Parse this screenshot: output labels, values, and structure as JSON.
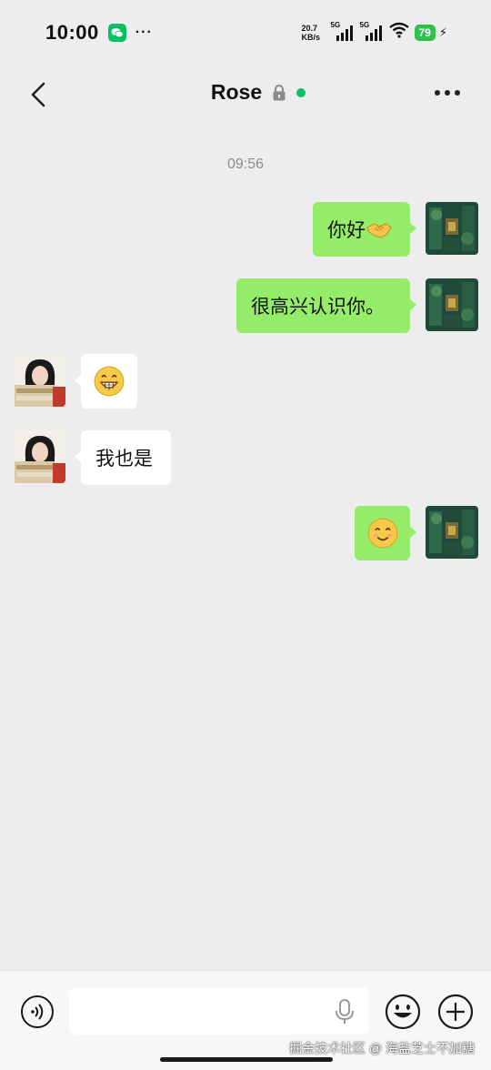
{
  "status_bar": {
    "time": "10:00",
    "net_speed_value": "20.7",
    "net_speed_unit": "KB/s",
    "sim1_label": "5G",
    "sim2_label": "5G",
    "battery": "79",
    "charging_icon": "bolt-icon",
    "app_icon": "wechat-icon"
  },
  "nav": {
    "title": "Rose",
    "back_icon": "chevron-left-icon",
    "lock_icon": "lock-icon",
    "more_icon": "more-dots-icon",
    "online_color": "#07c160"
  },
  "timestamp": "09:56",
  "messages": [
    {
      "from": "me",
      "text": "你好",
      "emoji": "handshake"
    },
    {
      "from": "me",
      "text": "很高兴认识你。"
    },
    {
      "from": "other",
      "text": "",
      "emoji": "grin"
    },
    {
      "from": "other",
      "text": "我也是"
    },
    {
      "from": "me",
      "text": "",
      "emoji": "smile"
    }
  ],
  "input_bar": {
    "placeholder": "",
    "voice_icon": "voice-icon",
    "mic_icon": "microphone-icon",
    "emoji_icon": "emoji-icon",
    "plus_icon": "plus-icon"
  },
  "watermark": "掘金技术社区 @ 海盐芝士不加糖",
  "colors": {
    "background": "#ededed",
    "my_bubble": "#95ec69",
    "their_bubble": "#ffffff",
    "accent": "#07c160"
  }
}
